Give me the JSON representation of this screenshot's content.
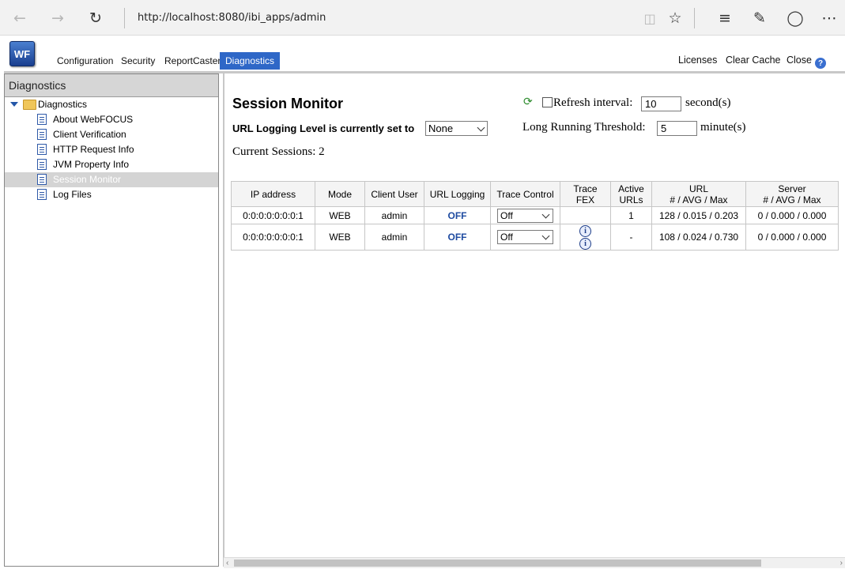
{
  "browser": {
    "url": "http://localhost:8080/ibi_apps/admin",
    "icons": [
      "back-arrow-icon",
      "forward-arrow-icon",
      "refresh-icon",
      "reading-view-icon",
      "favorite-star-icon",
      "hub-icon",
      "web-note-icon",
      "share-icon",
      "more-icon"
    ]
  },
  "app": {
    "logo_text": "WF",
    "nav": [
      "Configuration",
      "Security",
      "ReportCaster",
      "Diagnostics"
    ],
    "active_nav": "Diagnostics",
    "right_links": {
      "licenses": "Licenses",
      "clear_cache": "Clear Cache",
      "close": "Close"
    },
    "accent_color": "#2e67c7"
  },
  "sidebar": {
    "title": "Diagnostics",
    "root": "Diagnostics",
    "items": [
      {
        "label": "About WebFOCUS"
      },
      {
        "label": "Client Verification"
      },
      {
        "label": "HTTP Request Info"
      },
      {
        "label": "JVM Property Info"
      },
      {
        "label": "Session Monitor",
        "selected": true
      },
      {
        "label": "Log Files"
      }
    ]
  },
  "main": {
    "title": "Session Monitor",
    "refresh_label": "Refresh interval:",
    "refresh_value": "10",
    "refresh_unit": "second(s)",
    "url_logging_label": "URL Logging Level is currently set to",
    "url_logging_value": "None",
    "threshold_label": "Long Running Threshold:",
    "threshold_value": "5",
    "threshold_unit": "minute(s)",
    "current_sessions": "Current Sessions: 2"
  },
  "table": {
    "headers": [
      "IP address",
      "Mode",
      "Client User",
      "URL Logging",
      "Trace Control",
      "Trace FEX",
      "Active URLs",
      "URL # / AVG / Max",
      "Server # / AVG / Max"
    ],
    "header_lines": {
      "active": [
        "Active",
        "URLs"
      ],
      "url": [
        "URL",
        "# / AVG / Max"
      ],
      "server": [
        "Server",
        "# / AVG / Max"
      ]
    },
    "rows": [
      {
        "ip": "0:0:0:0:0:0:0:1",
        "mode": "WEB",
        "user": "admin",
        "url_logging": "OFF",
        "trace_control": "Off",
        "trace_fex_icons": 0,
        "active_urls": "1",
        "url_stats": "128 / 0.015 / 0.203",
        "server_stats": "0 / 0.000 / 0.000"
      },
      {
        "ip": "0:0:0:0:0:0:0:1",
        "mode": "WEB",
        "user": "admin",
        "url_logging": "OFF",
        "trace_control": "Off",
        "trace_fex_icons": 2,
        "active_urls": "-",
        "url_stats": "108 / 0.024 / 0.730",
        "server_stats": "0 / 0.000 / 0.000"
      }
    ]
  }
}
